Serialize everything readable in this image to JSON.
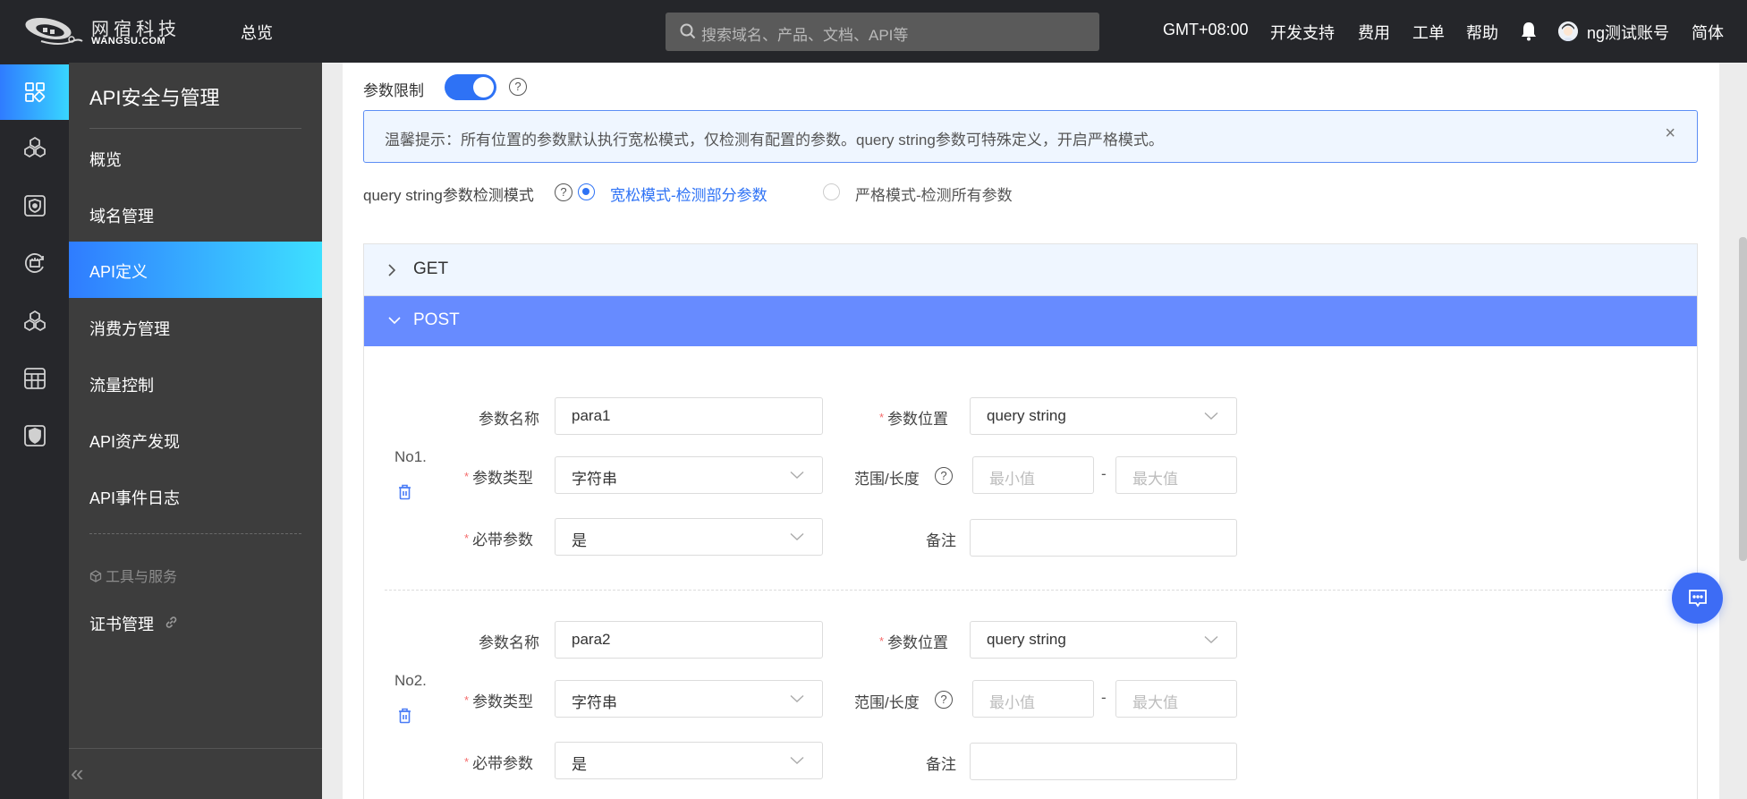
{
  "header": {
    "logo_cn": "网宿科技",
    "logo_en": "WANGSU.COM",
    "nav_overview": "总览",
    "search_placeholder": "搜索域名、产品、文档、API等",
    "timezone": "GMT+08:00",
    "dev_support": "开发支持",
    "billing": "费用",
    "tickets": "工单",
    "help": "帮助",
    "username": "ng测试账号",
    "language": "简体"
  },
  "rail": {
    "icons": [
      "grid-apps-icon",
      "cubes-icon",
      "shield-icon",
      "security-cycle-icon",
      "cubes-icon",
      "table-icon",
      "shield-badge-icon"
    ]
  },
  "sidebar": {
    "title": "API安全与管理",
    "items": [
      {
        "label": "概览",
        "active": false
      },
      {
        "label": "域名管理",
        "active": false
      },
      {
        "label": "API定义",
        "active": true
      },
      {
        "label": "消费方管理",
        "active": false
      },
      {
        "label": "流量控制",
        "active": false
      },
      {
        "label": "API资产发现",
        "active": false
      },
      {
        "label": "API事件日志",
        "active": false
      }
    ],
    "group_label": "工具与服务",
    "tools": [
      {
        "label": "证书管理",
        "external": true
      }
    ],
    "collapse": "«"
  },
  "main": {
    "param_limit_label": "参数限制",
    "param_limit_enabled": true,
    "alert_text": "温馨提示：所有位置的参数默认执行宽松模式，仅检测有配置的参数。query string参数可特殊定义，开启严格模式。",
    "alert_close": "×",
    "qs_mode_label": "query string参数检测模式",
    "qs_modes": [
      {
        "label": "宽松模式-检测部分参数",
        "selected": true
      },
      {
        "label": "严格模式-检测所有参数",
        "selected": false
      }
    ],
    "methods": [
      {
        "label": "GET",
        "expanded": false
      },
      {
        "label": "POST",
        "expanded": true
      }
    ],
    "labels": {
      "name": "参数名称",
      "position": "参数位置",
      "type": "参数类型",
      "range": "范围/长度",
      "required": "必带参数",
      "remark": "备注",
      "min_placeholder": "最小值",
      "max_placeholder": "最大值",
      "range_sep": "-"
    },
    "params": [
      {
        "no": "No1.",
        "name": "para1",
        "position": "query string",
        "type": "字符串",
        "min": "",
        "max": "",
        "required": "是",
        "remark": ""
      },
      {
        "no": "No2.",
        "name": "para2",
        "position": "query string",
        "type": "字符串",
        "min": "",
        "max": "",
        "required": "是",
        "remark": ""
      }
    ]
  },
  "colors": {
    "accent": "#2e72f5",
    "post_header": "#678bff",
    "get_header": "#eff6ff",
    "required_star": "#f56c6c"
  }
}
